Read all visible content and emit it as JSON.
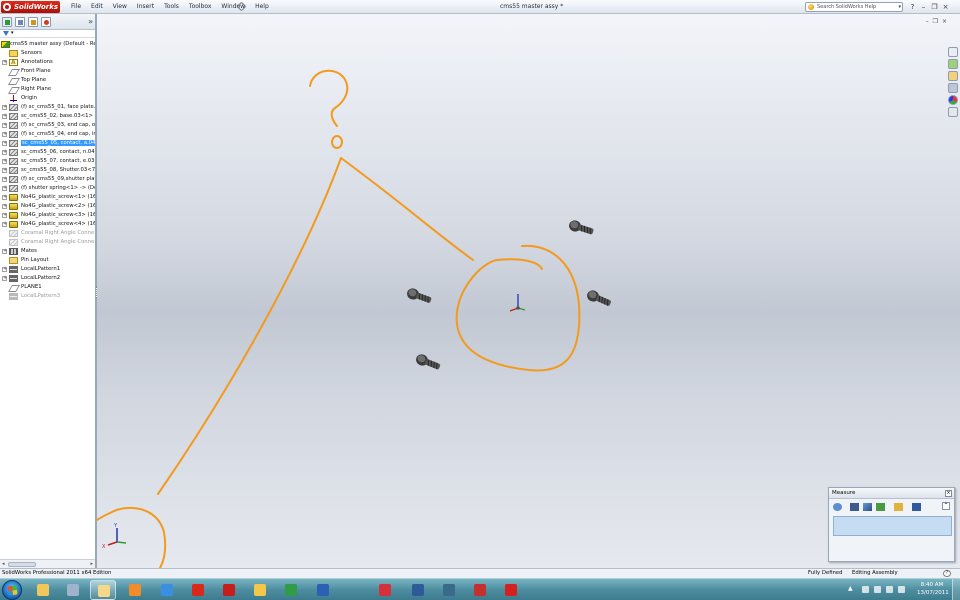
{
  "titlebar": {
    "brand": "SolidWorks",
    "menus": [
      "File",
      "Edit",
      "View",
      "Insert",
      "Tools",
      "Toolbox",
      "Window",
      "Help"
    ],
    "document_title": "cms55 master assy *",
    "help_search_placeholder": "Search SolidWorks Help",
    "help_menu_glyph": "?",
    "window_controls": [
      "–",
      "❐",
      "×"
    ]
  },
  "feature_tree": {
    "expand_glyph": "»",
    "nodes": [
      {
        "label": "cms55 master assy  (Default - Re",
        "icon": "assembly-icon",
        "root": true
      },
      {
        "label": "Sensors",
        "icon": "sensor-folder-icon"
      },
      {
        "label": "Annotations",
        "icon": "annotations-icon",
        "expandable": true
      },
      {
        "label": "Front Plane",
        "icon": "plane-icon"
      },
      {
        "label": "Top Plane",
        "icon": "plane-icon"
      },
      {
        "label": "Right Plane",
        "icon": "plane-icon"
      },
      {
        "label": "Origin",
        "icon": "origin-icon"
      },
      {
        "label": "(f) sc_cms55_01, face plate.0",
        "icon": "part-icon",
        "expandable": true
      },
      {
        "label": "sc_cms55_02, base.03<1> ->",
        "icon": "part-icon",
        "expandable": true
      },
      {
        "label": "(f) sc_cms55_03, end cap, ou",
        "icon": "part-icon",
        "expandable": true
      },
      {
        "label": "(f) sc_cms55_04, end cap, ini",
        "icon": "part-icon",
        "expandable": true
      },
      {
        "label": "sc_cms55_05, contact, a.04<",
        "icon": "part-icon",
        "expandable": true,
        "selected": true
      },
      {
        "label": "sc_cms55_06, contact, n.04<",
        "icon": "part-icon",
        "expandable": true
      },
      {
        "label": "sc_cms55_07, contact, e.03<",
        "icon": "part-icon",
        "expandable": true
      },
      {
        "label": "sc_cms55_08, Shutter.03<7>",
        "icon": "part-icon",
        "expandable": true
      },
      {
        "label": "(f) sc_cms55_09,shutter plate",
        "icon": "part-icon",
        "expandable": true
      },
      {
        "label": "(f) shutter spring<1> -> (De",
        "icon": "part-icon",
        "expandable": true
      },
      {
        "label": "No4G_plastic_screw<1> (16n",
        "icon": "screw-icon",
        "expandable": true
      },
      {
        "label": "No4G_plastic_screw<2> (16n",
        "icon": "screw-icon",
        "expandable": true
      },
      {
        "label": "No4G_plastic_screw<3> (16n",
        "icon": "screw-icon",
        "expandable": true
      },
      {
        "label": "No4G_plastic_screw<4> (16n",
        "icon": "screw-icon",
        "expandable": true
      },
      {
        "label": "Coramal Right Angle Conne",
        "icon": "part-icon",
        "dim": true
      },
      {
        "label": "Coramal Right Angle Conne",
        "icon": "part-icon",
        "dim": true
      },
      {
        "label": "Mates",
        "icon": "mates-icon",
        "expandable": true
      },
      {
        "label": "Pin Layout",
        "icon": "folder-icon"
      },
      {
        "label": "LocalLPattern1",
        "icon": "pattern-icon",
        "expandable": true
      },
      {
        "label": "LocalLPattern2",
        "icon": "pattern-icon",
        "expandable": true
      },
      {
        "label": "PLANE1",
        "icon": "plane-icon"
      },
      {
        "label": "LocalLPattern3",
        "icon": "pattern-icon",
        "dim": true
      }
    ]
  },
  "viewport": {
    "annotation_color": "#f39a1e",
    "question_mark": "?",
    "triad_labels": {
      "x": "X",
      "y": "Y",
      "z": "Z"
    },
    "view_controls": [
      "–",
      "❐",
      "×"
    ]
  },
  "measure": {
    "title": "Measure",
    "close_glyph": "×",
    "collapse_glyph": "⌃"
  },
  "statusbar": {
    "app": "SolidWorks Professional 2011 x64 Edition",
    "defined": "Fully Defined",
    "editing": "Editing Assembly",
    "help_glyph": "?"
  },
  "taskbar": {
    "apps": [
      "explorer-icon",
      "calculator-icon",
      "folder-icon",
      "media-player-icon",
      "ie-icon",
      "solidworks-icon",
      "solidworks-2-icon",
      "outlook-icon",
      "excel-icon",
      "word-icon",
      "photo-icon",
      "photoshop-icon",
      "pen-icon",
      "app-icon",
      "acrobat-icon"
    ],
    "tray_arrow": "▲",
    "time": "8:40 AM",
    "date": "13/07/2011"
  },
  "colors": {
    "selection": "#3399ff",
    "brand_red": "#c3140b",
    "annotation_orange": "#f39a1e"
  }
}
